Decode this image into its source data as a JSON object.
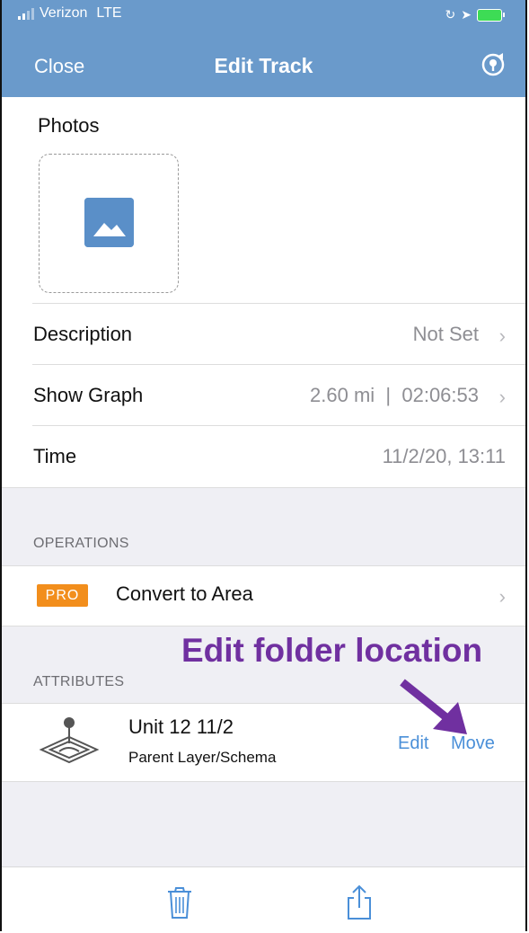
{
  "status_bar": {
    "carrier": "Verizon",
    "network": "LTE"
  },
  "nav": {
    "close_label": "Close",
    "title": "Edit Track",
    "pin_icon": "location-pin-icon"
  },
  "photos": {
    "label": "Photos"
  },
  "rows": [
    {
      "label": "Description",
      "value": "Not Set"
    },
    {
      "label": "Show Graph",
      "value": "2.60 mi  |  02:06:53"
    },
    {
      "label": "Time",
      "value": "11/2/20, 13:11"
    }
  ],
  "operations": {
    "header": "OPERATIONS",
    "pro_badge": "PRO",
    "convert_label": "Convert to Area"
  },
  "annotation": {
    "text": "Edit folder location",
    "color": "#7030a0"
  },
  "attributes": {
    "header": "ATTRIBUTES",
    "name": "Unit 12 11/2",
    "subtitle": "Parent Layer/Schema",
    "edit_label": "Edit",
    "move_label": "Move"
  },
  "colors": {
    "nav_bg": "#6a9acb",
    "link": "#4a8fd8",
    "pro": "#f28e1c",
    "group_bg": "#efeff4"
  }
}
